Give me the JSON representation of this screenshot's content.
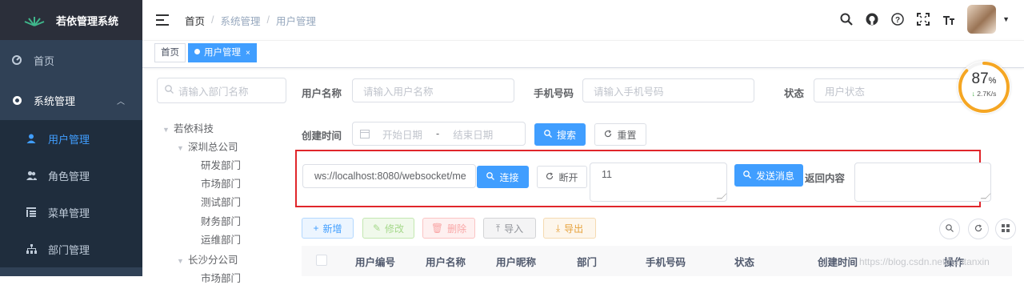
{
  "app": {
    "title": "若依管理系统"
  },
  "sidebar": {
    "home": "首页",
    "system": "系统管理",
    "items": [
      {
        "label": "用户管理",
        "active": true
      },
      {
        "label": "角色管理",
        "active": false
      },
      {
        "label": "菜单管理",
        "active": false
      },
      {
        "label": "部门管理",
        "active": false
      }
    ]
  },
  "breadcrumb": [
    "首页",
    "系统管理",
    "用户管理"
  ],
  "tags": {
    "home": "首页",
    "active": "用户管理",
    "close": "×"
  },
  "dept": {
    "placeholder": "请输入部门名称",
    "tree": [
      "若依科技",
      "深圳总公司",
      "研发部门",
      "市场部门",
      "测试部门",
      "财务部门",
      "运维部门",
      "长沙分公司",
      "市场部门"
    ]
  },
  "search": {
    "username_label": "用户名称",
    "username_placeholder": "请输入用户名称",
    "phone_label": "手机号码",
    "phone_placeholder": "请输入手机号码",
    "status_label": "状态",
    "status_placeholder": "用户状态",
    "date_label": "创建时间",
    "start_placeholder": "开始日期",
    "date_sep": "-",
    "end_placeholder": "结束日期",
    "search_button": "搜索",
    "reset_button": "重置"
  },
  "websocket": {
    "url": "ws://localhost:8080/websocket/me",
    "connect_button": "连接",
    "disconnect_button": "断开",
    "message": "11",
    "send_button": "发送消息",
    "return_label": "返回内容",
    "return_value": ""
  },
  "toolbar": {
    "add": "新增",
    "edit": "修改",
    "delete": "删除",
    "import": "导入",
    "export": "导出"
  },
  "table": {
    "columns": [
      "用户编号",
      "用户名称",
      "用户昵称",
      "部门",
      "手机号码",
      "状态",
      "创建时间",
      "操作"
    ]
  },
  "watermark": "https://blog.csdn.net/hantanxin",
  "gauge": {
    "percent": "87",
    "unit": "%",
    "speed": "2.7K/s",
    "level": 0.87
  },
  "colors": {
    "sidebar_bg": "#304156",
    "primary": "#409eff",
    "highlight_border": "#e0262b",
    "gauge": "#f5a623"
  }
}
